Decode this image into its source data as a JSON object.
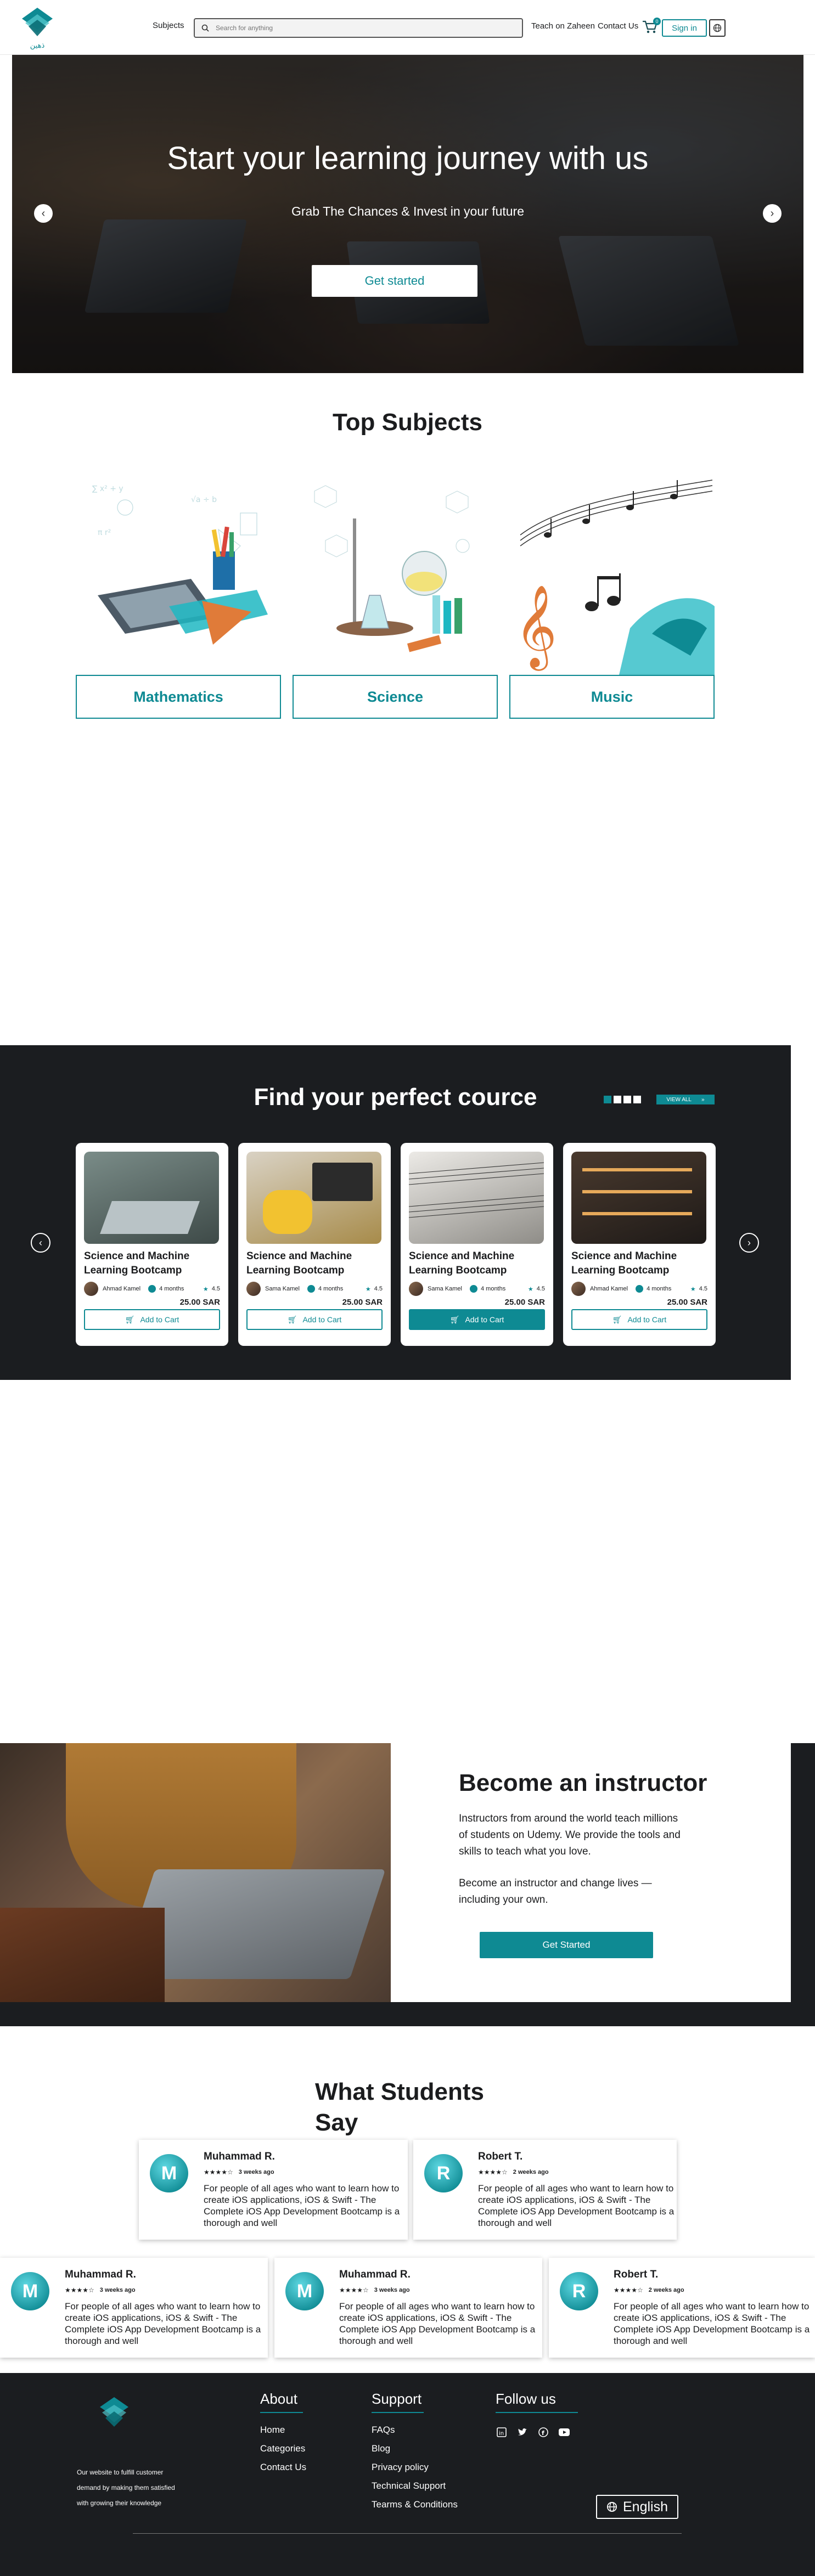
{
  "header": {
    "logo_text": "ذهين",
    "subjects_label": "Subjects",
    "search_placeholder": "Search for anything",
    "teach_label": "Teach on Zaheen",
    "contact_label": "Contact Us",
    "cart_count": "0",
    "signin_label": "Sign in"
  },
  "hero": {
    "title": "Start  your learning journey with us",
    "subtitle": "Grab The  Chances & Invest in your future",
    "cta_label": "Get started"
  },
  "subjects": {
    "title": "Top Subjects",
    "items": [
      {
        "label": "Mathematics",
        "icon": "math-illustration"
      },
      {
        "label": "Science",
        "icon": "science-illustration"
      },
      {
        "label": "Music",
        "icon": "music-illustration"
      }
    ]
  },
  "courses": {
    "title": "Find your perfect cource",
    "view_all_label": "VIEW ALL",
    "items": [
      {
        "title": "Science and Machine Learning Bootcamp",
        "instructor": "Ahmad Kamel",
        "duration": "4 months",
        "rating": "4.5",
        "price": "25.00 SAR",
        "cart_label": "Add to Cart"
      },
      {
        "title": "Science and Machine Learning Bootcamp",
        "instructor": "Sama Kamel",
        "duration": "4 months",
        "rating": "4.5",
        "price": "25.00 SAR",
        "cart_label": "Add to Cart"
      },
      {
        "title": "Science and Machine Learning Bootcamp",
        "instructor": "Sama Kamel",
        "duration": "4 months",
        "rating": "4.5",
        "price": "25.00 SAR",
        "cart_label": "Add to Cart"
      },
      {
        "title": "Science and Machine Learning Bootcamp",
        "instructor": "Ahmad Kamel",
        "duration": "4 months",
        "rating": "4.5",
        "price": "25.00 SAR",
        "cart_label": "Add to Cart"
      }
    ]
  },
  "instructor": {
    "title": "Become an instructor",
    "p1": "Instructors from around the world teach millions of students on Udemy. We provide the tools and skills to teach what you love.",
    "p2": "Become an instructor and change lives — including your own.",
    "cta_label": "Get Started"
  },
  "testimonials": {
    "title": "What Students Say",
    "items": [
      {
        "initial": "M",
        "name": "Muhammad R.",
        "stars": "★★★★☆",
        "time": "3 weeks ago",
        "text": "For people of all ages who want to learn how to create iOS applications, iOS & Swift - The Complete iOS App Development Bootcamp is a thorough and well"
      },
      {
        "initial": "R",
        "name": "Robert T.",
        "stars": "★★★★☆",
        "time": "2 weeks ago",
        "text": "For people of all ages who want to learn how to create iOS applications, iOS & Swift - The Complete iOS App Development Bootcamp is a thorough and well"
      },
      {
        "initial": "M",
        "name": "Muhammad R.",
        "stars": "★★★★☆",
        "time": "3 weeks ago",
        "text": "For people of all ages who want to learn how to create iOS applications, iOS & Swift - The Complete iOS App Development Bootcamp is a thorough and well"
      },
      {
        "initial": "M",
        "name": "Muhammad R.",
        "stars": "★★★★☆",
        "time": "3 weeks ago",
        "text": "For people of all ages who want to learn how to create iOS applications, iOS & Swift - The Complete iOS App Development Bootcamp is a thorough and well"
      },
      {
        "initial": "R",
        "name": "Robert T.",
        "stars": "★★★★☆",
        "time": "2 weeks ago",
        "text": "For people of all ages who want to learn how to create iOS applications, iOS & Swift - The Complete iOS App Development Bootcamp is a thorough and well"
      }
    ]
  },
  "footer": {
    "about_text": "Our website to fulfill customer demand by making them satisfied with growing their knowledge",
    "about_title": "About",
    "about_links": [
      "Home",
      "Categories",
      "Contact Us"
    ],
    "support_title": "Support",
    "support_links": [
      "FAQs",
      "Blog",
      "Privacy policy",
      "Technical Support",
      "Tearms & Conditions"
    ],
    "follow_title": "Follow us",
    "language_label": "English"
  },
  "colors": {
    "accent": "#0e8a93",
    "dark": "#1b1d20"
  }
}
